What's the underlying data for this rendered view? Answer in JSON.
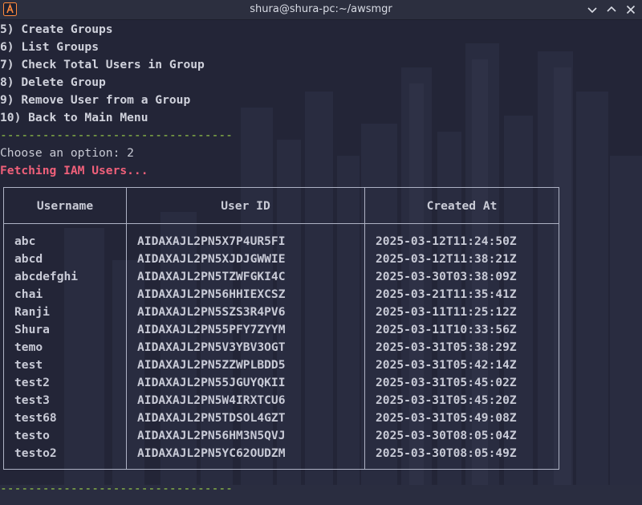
{
  "window": {
    "title": "shura@shura-pc:~/awsmgr",
    "icon": "terminal-app-icon",
    "accent_color": "#ff8a3d"
  },
  "terminal": {
    "menu_items": [
      "5) Create Groups",
      "6) List Groups",
      "7) Check Total Users in Group",
      "8) Delete Group",
      "9) Remove User from a Group",
      "10) Back to Main Menu"
    ],
    "separator": "---------------------------------",
    "prompt": "Choose an option: 2",
    "status": "Fetching IAM Users...",
    "status_color": "#f0607a",
    "separator_color": "#9bcf4a",
    "table": {
      "headers": [
        "Username",
        "User ID",
        "Created At"
      ],
      "rows": [
        [
          "abc",
          "AIDAXAJL2PN5X7P4UR5FI",
          "2025-03-12T11:24:50Z"
        ],
        [
          "abcd",
          "AIDAXAJL2PN5XJDJGWWIE",
          "2025-03-12T11:38:21Z"
        ],
        [
          "abcdefghi",
          "AIDAXAJL2PN5TZWFGKI4C",
          "2025-03-30T03:38:09Z"
        ],
        [
          "chai",
          "AIDAXAJL2PN56HHIEXCSZ",
          "2025-03-21T11:35:41Z"
        ],
        [
          "Ranji",
          "AIDAXAJL2PN5SZS3R4PV6",
          "2025-03-11T11:25:12Z"
        ],
        [
          "Shura",
          "AIDAXAJL2PN55PFY7ZYYM",
          "2025-03-11T10:33:56Z"
        ],
        [
          "temo",
          "AIDAXAJL2PN5V3YBV3OGT",
          "2025-03-31T05:38:29Z"
        ],
        [
          "test",
          "AIDAXAJL2PN5ZZWPLBDD5",
          "2025-03-31T05:42:14Z"
        ],
        [
          "test2",
          "AIDAXAJL2PN55JGUYQKII",
          "2025-03-31T05:45:02Z"
        ],
        [
          "test3",
          "AIDAXAJL2PN5W4IRXTCU6",
          "2025-03-31T05:45:20Z"
        ],
        [
          "test68",
          "AIDAXAJL2PN5TDSOL4GZT",
          "2025-03-31T05:49:08Z"
        ],
        [
          "testo",
          "AIDAXAJL2PN56HM3N5QVJ",
          "2025-03-30T08:05:04Z"
        ],
        [
          "testo2",
          "AIDAXAJL2PN5YC62OUDZM",
          "2025-03-30T08:05:49Z"
        ]
      ]
    }
  }
}
